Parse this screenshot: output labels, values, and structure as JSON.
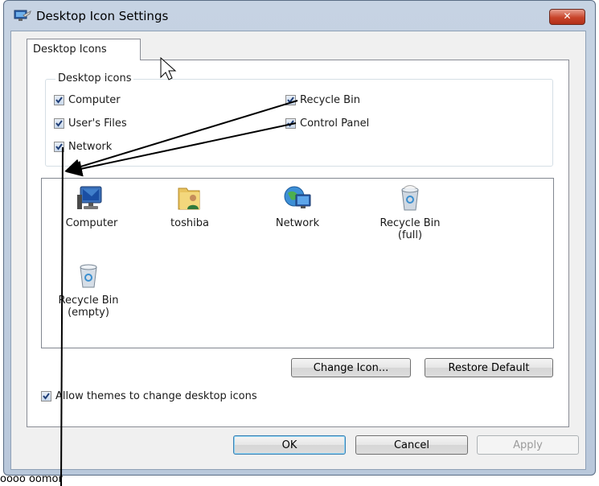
{
  "window": {
    "title": "Desktop Icon Settings",
    "close_label": "✕"
  },
  "tab": {
    "label": "Desktop Icons"
  },
  "group": {
    "label": "Desktop icons",
    "checkboxes": [
      {
        "label": "Computer",
        "checked": true
      },
      {
        "label": "User's Files",
        "checked": true
      },
      {
        "label": "Network",
        "checked": true
      },
      {
        "label": "Recycle Bin",
        "checked": true
      },
      {
        "label": "Control Panel",
        "checked": true
      }
    ]
  },
  "icons": [
    {
      "label": "Computer",
      "icon": "computer-icon"
    },
    {
      "label": "toshiba",
      "icon": "user-folder-icon"
    },
    {
      "label": "Network",
      "icon": "network-icon"
    },
    {
      "label": "Recycle Bin\n(full)",
      "line1": "Recycle Bin",
      "line2": "(full)",
      "icon": "recycle-bin-full-icon"
    },
    {
      "label": "Recycle Bin\n(empty)",
      "line1": "Recycle Bin",
      "line2": "(empty)",
      "icon": "recycle-bin-empty-icon"
    }
  ],
  "buttons": {
    "change_icon": "Change Icon...",
    "restore_default": "Restore Default",
    "ok": "OK",
    "cancel": "Cancel",
    "apply": "Apply"
  },
  "allow_themes": {
    "label": "Allow themes to change desktop icons",
    "checked": true
  },
  "partial_background_text": "oooo oomor"
}
